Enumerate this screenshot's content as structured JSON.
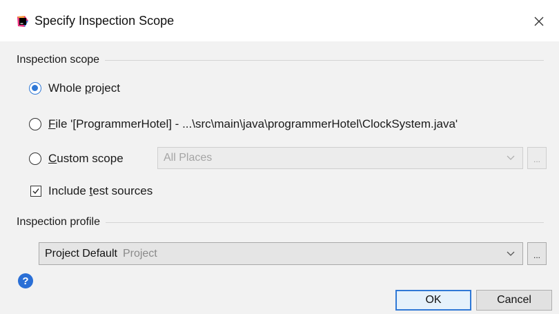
{
  "window": {
    "title": "Specify Inspection Scope"
  },
  "scope_group": {
    "title": "Inspection scope",
    "options": [
      {
        "pre": "Whole ",
        "mnemonic": "p",
        "post": "roject",
        "checked": true
      },
      {
        "pre": "",
        "mnemonic": "F",
        "post": "ile '[ProgrammerHotel] - ...\\src\\main\\java\\programmerHotel\\ClockSystem.java'",
        "checked": false
      },
      {
        "pre": "",
        "mnemonic": "C",
        "post": "ustom scope",
        "checked": false
      }
    ],
    "custom_scope_value": "All Places",
    "ellipsis": "...",
    "include_tests": {
      "pre": "Include ",
      "mnemonic": "t",
      "post": "est sources",
      "checked": true
    }
  },
  "profile_group": {
    "title": "Inspection profile",
    "selected_name": "Project Default",
    "selected_kind": "Project",
    "ellipsis": "..."
  },
  "footer": {
    "help_glyph": "?",
    "ok_label": "OK",
    "cancel_label": "Cancel"
  },
  "colors": {
    "accent": "#2f78d6",
    "help": "#2a6fd6",
    "panel_bg": "#f2f2f2"
  },
  "icons": {
    "app": "intellij-app-icon",
    "close": "close-icon",
    "dropdown": "chevron-down-icon",
    "check": "checkmark-icon"
  }
}
